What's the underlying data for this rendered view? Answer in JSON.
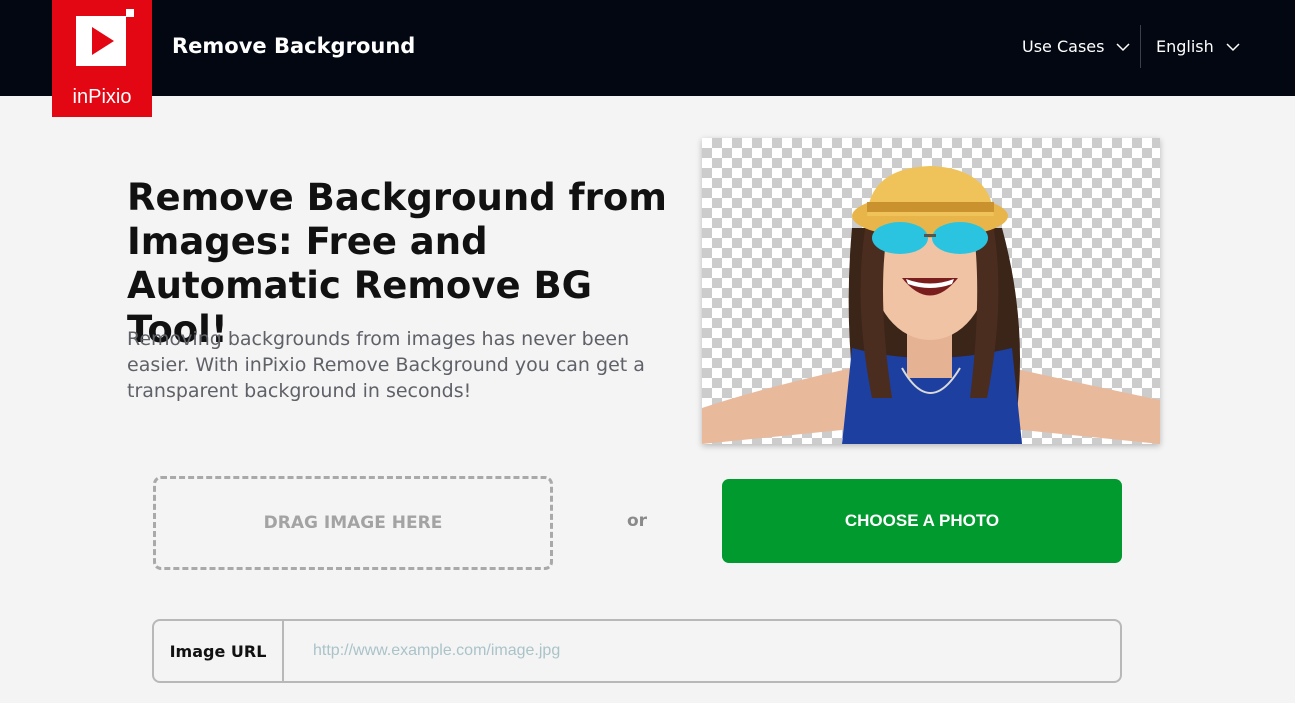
{
  "header": {
    "logo_text": "inPixio",
    "app_title": "Remove Background",
    "nav": {
      "use_cases": "Use Cases",
      "language": "English"
    }
  },
  "hero": {
    "title": "Remove Background from Images: Free and Automatic Remove BG Tool!",
    "description": "Removing backgrounds from images has never been easier. With inPixio Remove Background you can get a transparent background in seconds!"
  },
  "upload": {
    "drag_label": "DRAG IMAGE HERE",
    "or_label": "or",
    "choose_button": "CHOOSE A PHOTO"
  },
  "url_field": {
    "label": "Image URL",
    "placeholder": "http://www.example.com/image.jpg",
    "value": ""
  },
  "colors": {
    "header_bg": "#030712",
    "brand_red": "#e30613",
    "button_green": "#009a2e"
  },
  "icons": [
    "play-logo-icon",
    "chevron-down-icon"
  ]
}
